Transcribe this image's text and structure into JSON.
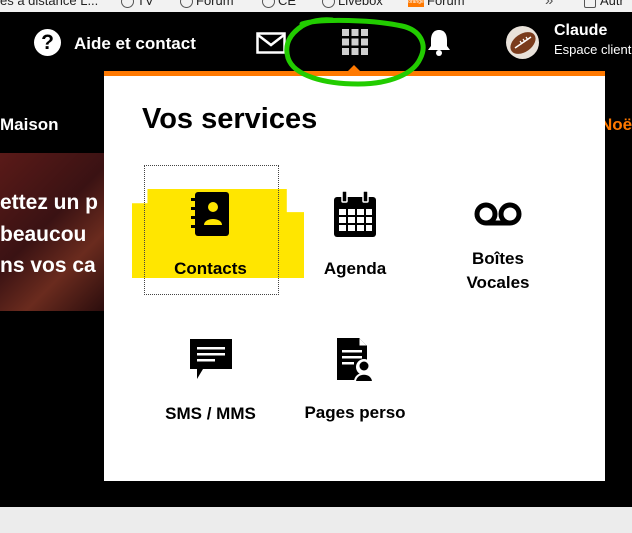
{
  "bookmarks": [
    {
      "label": "es à distance L...",
      "icon": "none"
    },
    {
      "label": "TV",
      "icon": "globe-icon"
    },
    {
      "label": "Forum",
      "icon": "globe-icon"
    },
    {
      "label": "CE",
      "icon": "globe-icon"
    },
    {
      "label": "Livebox",
      "icon": "globe-icon"
    },
    {
      "label": "Forum",
      "icon": "orange-logo"
    },
    {
      "label": "Autr",
      "icon": "folder-icon"
    }
  ],
  "nav": {
    "help_label": "Aide et contact",
    "help_icon": "?",
    "user_name": "Claude",
    "user_space": "Espace client"
  },
  "background": {
    "maison": "Maison",
    "noel": "Noël",
    "hero_lines": [
      "ettez un p",
      "beaucou",
      "ns vos ca"
    ]
  },
  "panel": {
    "title": "Vos services",
    "services": [
      {
        "label": "Contacts",
        "icon": "contacts-book-icon"
      },
      {
        "label": "Agenda",
        "icon": "calendar-icon"
      },
      {
        "label": "Boîtes Vocales",
        "icon": "voicemail-icon"
      },
      {
        "label": "SMS / MMS",
        "icon": "sms-icon"
      },
      {
        "label": "Pages perso",
        "icon": "pages-perso-icon"
      }
    ]
  },
  "colors": {
    "accent": "#ff7900",
    "highlight": "#ffe600",
    "annotation": "#22cc00"
  }
}
